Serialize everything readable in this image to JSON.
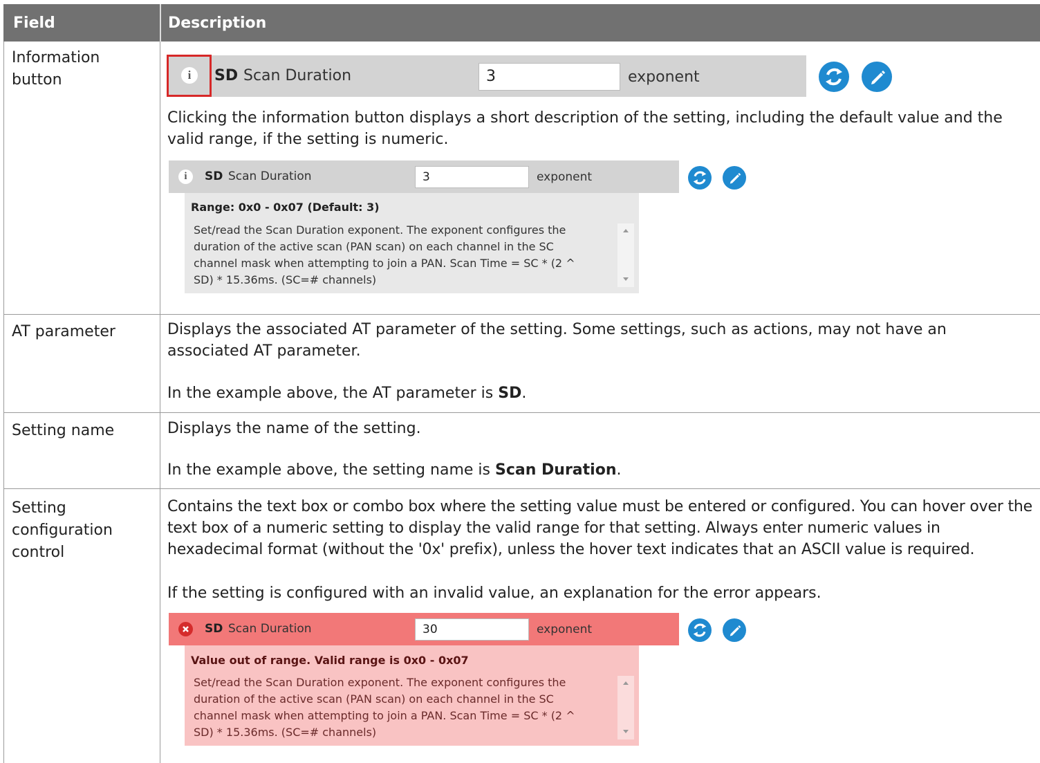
{
  "header": {
    "field": "Field",
    "description": "Description"
  },
  "rows": [
    {
      "field": "Information button",
      "description": "Clicking the information button displays a short description of the setting, including the default value and the valid range, if the setting is numeric."
    },
    {
      "field": "AT parameter",
      "description": "Displays the associated AT parameter of the setting. Some settings, such as actions, may not have an associated AT parameter.",
      "example_prefix": "In the example above, the AT parameter is ",
      "example_value": "SD",
      "example_suffix": "."
    },
    {
      "field": "Setting name",
      "description": "Displays the name of the setting.",
      "example_prefix": "In the example above, the setting name is ",
      "example_value": "Scan Duration",
      "example_suffix": "."
    },
    {
      "field": "Setting configuration control",
      "description": "Contains the text box or combo box where the setting value must be entered or configured. You can hover over the text box of a numeric setting to display the valid range for that setting. Always enter numeric values in hexadecimal format (without the '0x' prefix), unless the hover text indicates that an ASCII value is required.",
      "description2": "If the setting is configured with an invalid value, an explanation for the error appears."
    }
  ],
  "setting": {
    "at": "SD",
    "name": "Scan Duration",
    "unit": "exponent",
    "info_icon": "i",
    "value": "3",
    "invalid_value": "30",
    "range_title": "Range: 0x0 - 0x07 (Default: 3)",
    "error_title": "Value out of range. Valid range is 0x0 - 0x07",
    "help_lines": [
      "Set/read the Scan Duration exponent. The exponent configures the",
      "duration of the active scan (PAN scan) on each channel in the SC",
      "channel mask when attempting to join a PAN. Scan Time = SC * (2 ^",
      "SD) * 15.36ms. (SC=# channels)"
    ]
  },
  "icons": {
    "info": "info-icon",
    "error": "error-icon",
    "refresh": "refresh-icon",
    "write": "write-pencil-icon"
  },
  "colors": {
    "header_bg": "#717171",
    "setting_bg": "#d3d3d3",
    "error_bg": "#f27878",
    "button_blue": "#1f8ad0",
    "highlight_red": "#d72828"
  }
}
